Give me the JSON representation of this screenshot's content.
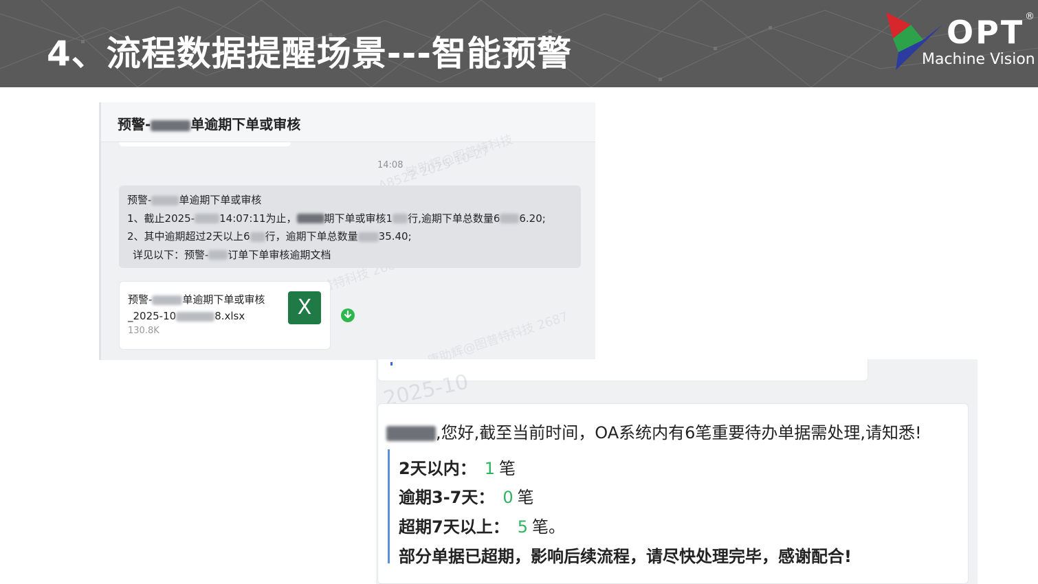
{
  "header": {
    "title": "4、流程数据提醒场景---智能预警",
    "logo": {
      "brand": "OPT",
      "registered": "®",
      "tagline": "Machine Vision"
    }
  },
  "top_screenshot": {
    "title_prefix": "预警-",
    "title_suffix": "单逾期下单或审核",
    "time": "14:08",
    "message": {
      "l1a": "预警-",
      "l1b": "单逾期下单或审核",
      "l2a": "1、截止2025-",
      "l2b": "14:07:11为止，",
      "l2c": "期下单或审核1",
      "l2d": "行,逾期下单总数量6",
      "l2e": "6.20;",
      "l3a": "2、其中逾期超过2天以上6",
      "l3b": "行，逾期下单总数量",
      "l3c": "35.40;",
      "l4a": "详见以下：预警-",
      "l4b": "订单下单审核逾期文档"
    },
    "file": {
      "name_a": "预警-",
      "name_b": "单逾期下单或审核",
      "name_c": "_2025-10",
      "name_d": "8.xlsx",
      "size": "130.8K",
      "icon_letter": "X"
    }
  },
  "bottom_screenshot": {
    "greeting": ",您好,截至当前时间，OA系统内有6笔重要待办单据需处理,请知悉!",
    "rows": [
      {
        "label": "2天以内：",
        "count": "1",
        "unit": "笔"
      },
      {
        "label": "逾期3-7天：",
        "count": "0",
        "unit": "笔"
      },
      {
        "label": "超期7天以上：",
        "count": "5",
        "unit": "笔。"
      }
    ],
    "notice": "部分单据已超期，影响后续流程，请尽快处理完毕，感谢配合!"
  },
  "colors": {
    "banner": "#5a5a5a",
    "count_green": "#2fb35f",
    "quote_bar": "#5c8fdc",
    "excel_green": "#1f7a45"
  }
}
